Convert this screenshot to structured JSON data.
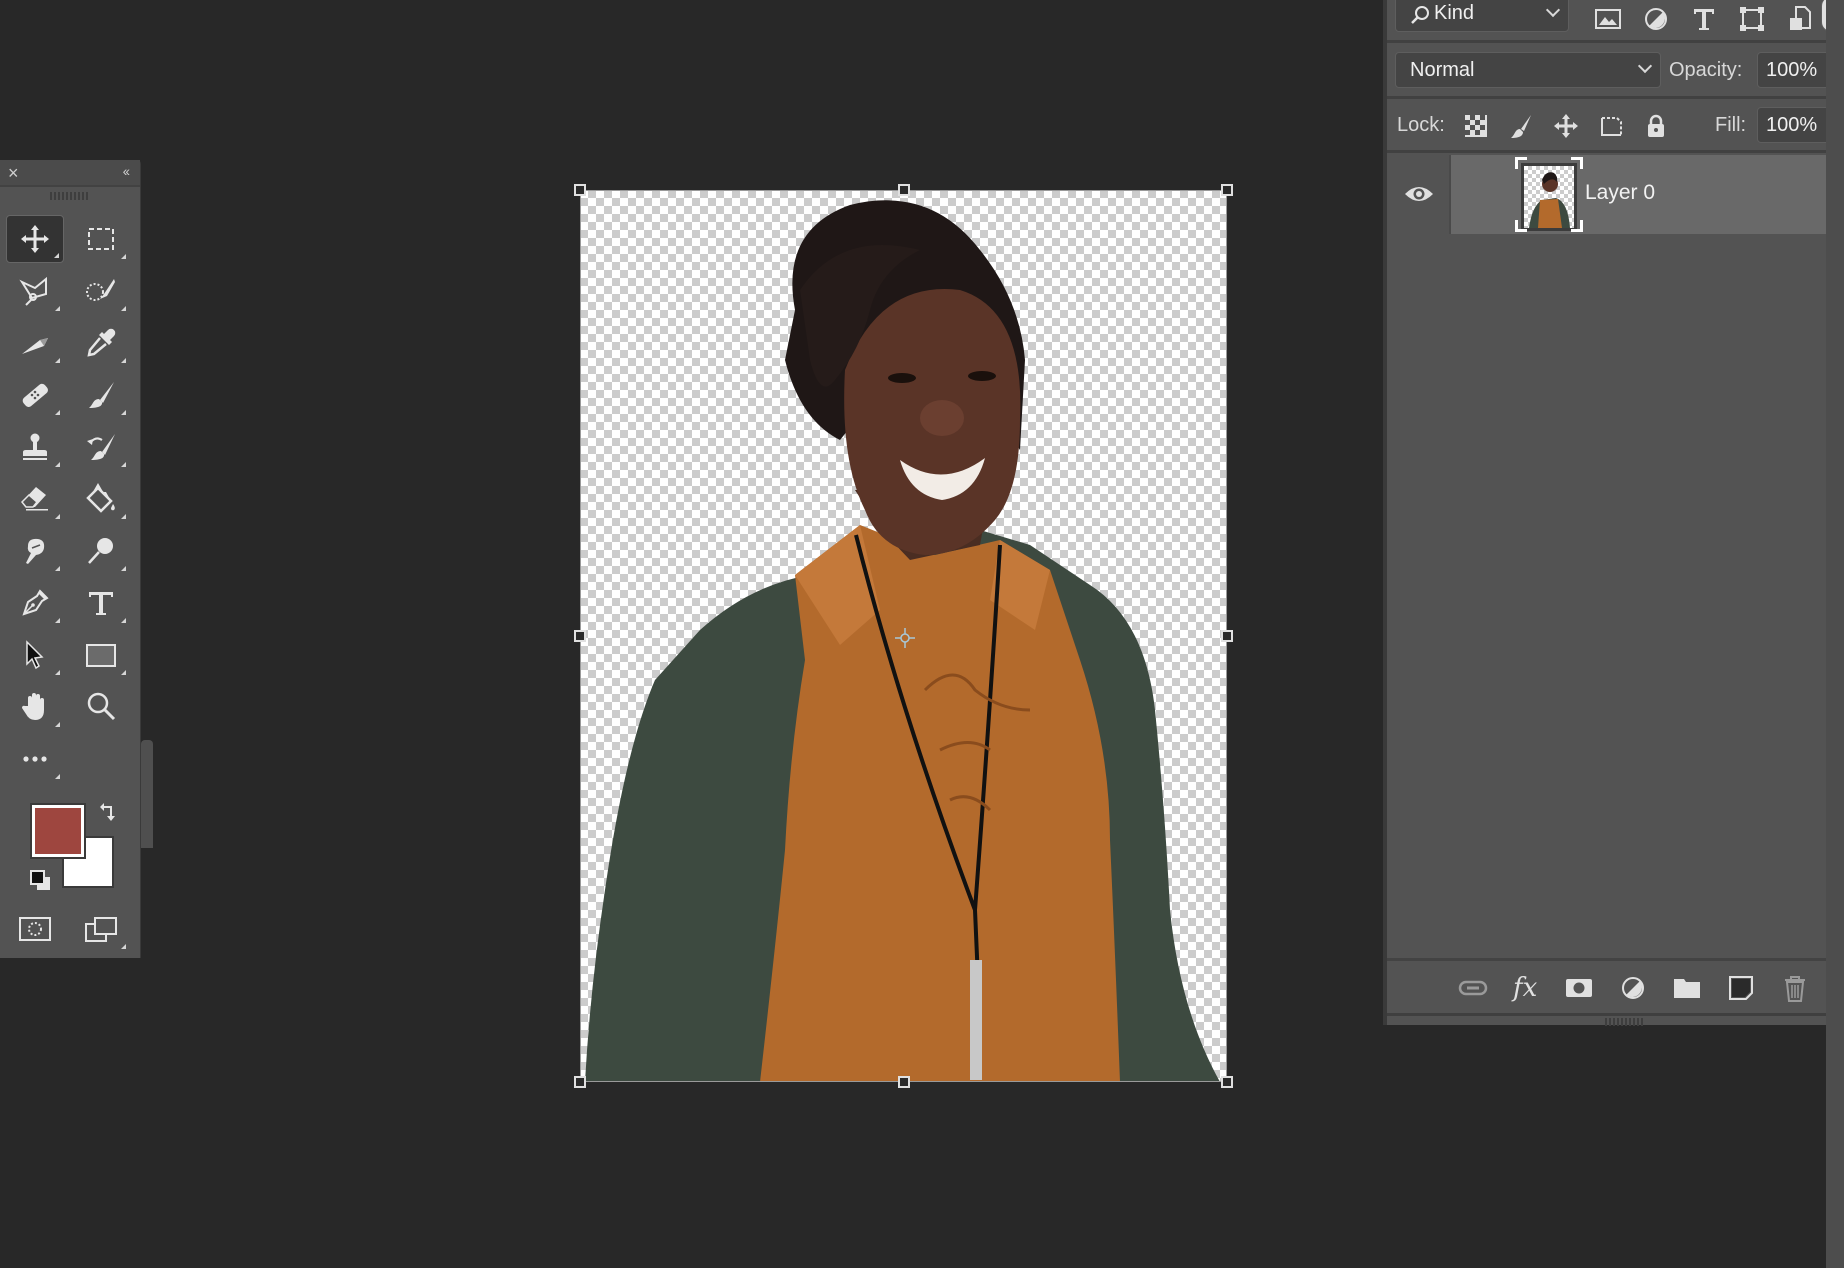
{
  "app": "Photoshop",
  "toolbar": {
    "close_label": "×",
    "collapse_label": "‹‹",
    "tools": [
      {
        "name": "move-tool",
        "icon": "move-icon",
        "active": true
      },
      {
        "name": "rectangular-marquee-tool",
        "icon": "marquee-icon"
      },
      {
        "name": "polygonal-lasso-tool",
        "icon": "lasso-icon"
      },
      {
        "name": "quick-selection-tool",
        "icon": "quick-selection-icon"
      },
      {
        "name": "crop-tool",
        "icon": "crop-blade-icon"
      },
      {
        "name": "eyedropper-tool",
        "icon": "eyedropper-icon"
      },
      {
        "name": "healing-brush-tool",
        "icon": "bandage-icon"
      },
      {
        "name": "brush-tool",
        "icon": "brush-icon"
      },
      {
        "name": "clone-stamp-tool",
        "icon": "stamp-icon"
      },
      {
        "name": "history-brush-tool",
        "icon": "history-brush-icon"
      },
      {
        "name": "eraser-tool",
        "icon": "eraser-icon"
      },
      {
        "name": "paint-bucket-tool",
        "icon": "paint-bucket-icon"
      },
      {
        "name": "smudge-tool",
        "icon": "smudge-icon"
      },
      {
        "name": "dodge-tool",
        "icon": "dodge-icon"
      },
      {
        "name": "pen-tool",
        "icon": "pen-icon"
      },
      {
        "name": "type-tool",
        "icon": "type-icon"
      },
      {
        "name": "path-selection-tool",
        "icon": "arrow-icon"
      },
      {
        "name": "rectangle-tool",
        "icon": "rectangle-icon"
      },
      {
        "name": "hand-tool",
        "icon": "hand-icon"
      },
      {
        "name": "zoom-tool",
        "icon": "zoom-icon"
      },
      {
        "name": "edit-toolbar",
        "icon": "more-icon"
      }
    ],
    "foreground_color": "#9e463f",
    "background_color": "#ffffff"
  },
  "layers_panel": {
    "filter": {
      "label": "Kind"
    },
    "filter_icons": [
      "image-filter-icon",
      "adjustment-filter-icon",
      "type-filter-icon",
      "shape-filter-icon",
      "smart-object-filter-icon"
    ],
    "blend_mode": "Normal",
    "opacity_label": "Opacity:",
    "opacity_value": "100%",
    "lock_label": "Lock:",
    "fill_label": "Fill:",
    "fill_value": "100%",
    "layers": [
      {
        "name": "Layer 0",
        "visible": true,
        "selected": true
      }
    ],
    "footer_icons": [
      "link-layers-icon",
      "fx-icon",
      "add-mask-icon",
      "adjustment-layer-icon",
      "new-group-icon",
      "new-layer-icon",
      "delete-layer-icon"
    ],
    "fx_label": "fx"
  },
  "canvas": {
    "content": "Portrait photo of smiling woman with transparent background",
    "transform_active": true
  }
}
